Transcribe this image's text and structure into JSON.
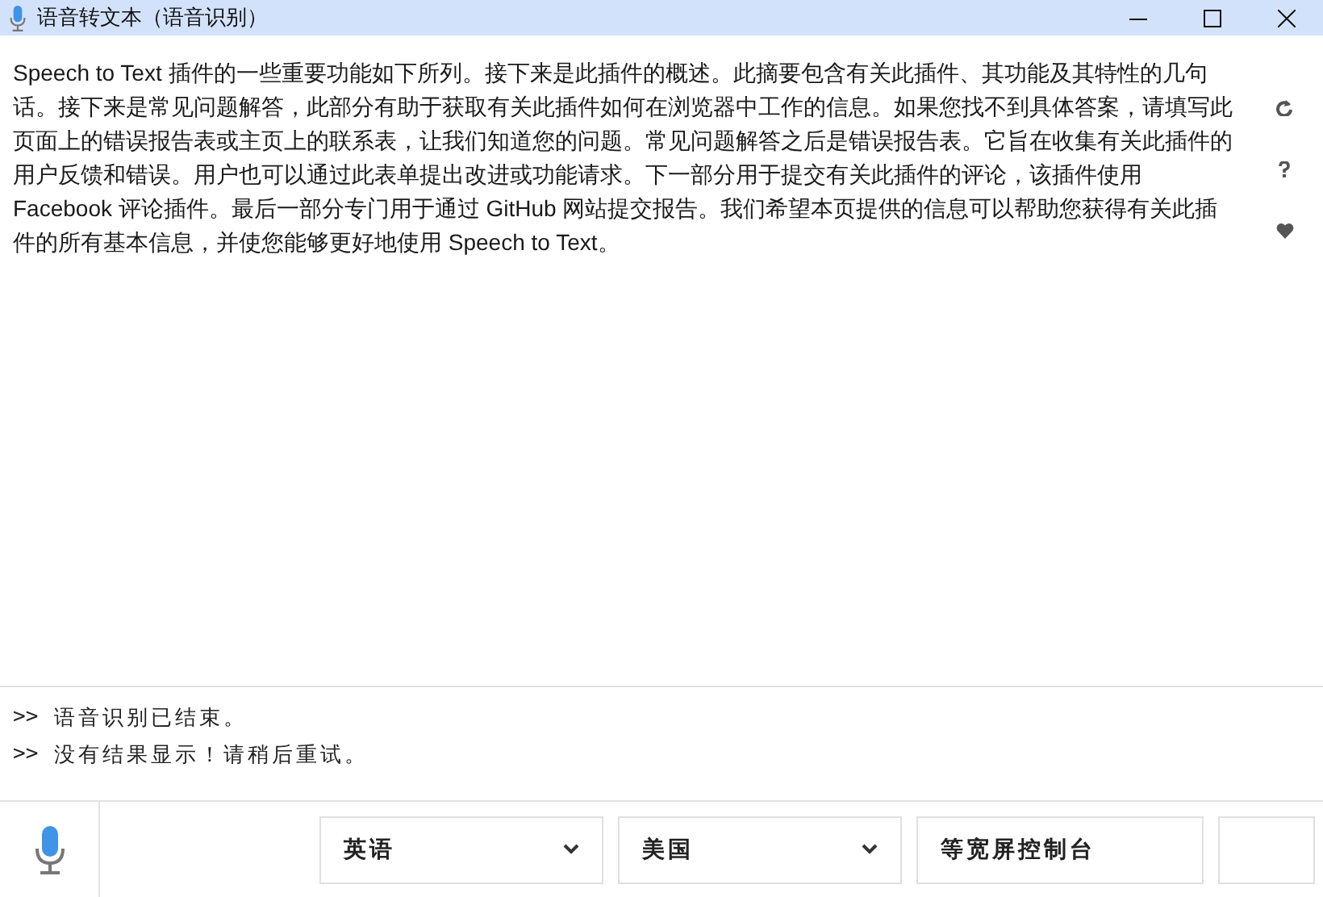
{
  "window": {
    "title": "语音转文本（语音识别）"
  },
  "content": {
    "text": "Speech to Text 插件的一些重要功能如下所列。接下来是此插件的概述。此摘要包含有关此插件、其功能及其特性的几句话。接下来是常见问题解答，此部分有助于获取有关此插件如何在浏览器中工作的信息。如果您找不到具体答案，请填写此页面上的错误报告表或主页上的联系表，让我们知道您的问题。常见问题解答之后是错误报告表。它旨在收集有关此插件的用户反馈和错误。用户也可以通过此表单提出改进或功能请求。下一部分用于提交有关此插件的评论，该插件使用 Facebook 评论插件。最后一部分专门用于通过 GitHub 网站提交报告。我们希望本页提供的信息可以帮助您获得有关此插件的所有基本信息，并使您能够更好地使用 Speech to Text。"
  },
  "log": [
    {
      "prompt": ">>",
      "text": "语音识别已结束。"
    },
    {
      "prompt": ">>",
      "text": "没有结果显示！请稍后重试。"
    }
  ],
  "controls": [
    {
      "kind": "select",
      "value": "英语"
    },
    {
      "kind": "select",
      "value": "美国"
    },
    {
      "kind": "button",
      "value": "等宽屏控制台"
    },
    {
      "kind": "button"
    }
  ]
}
